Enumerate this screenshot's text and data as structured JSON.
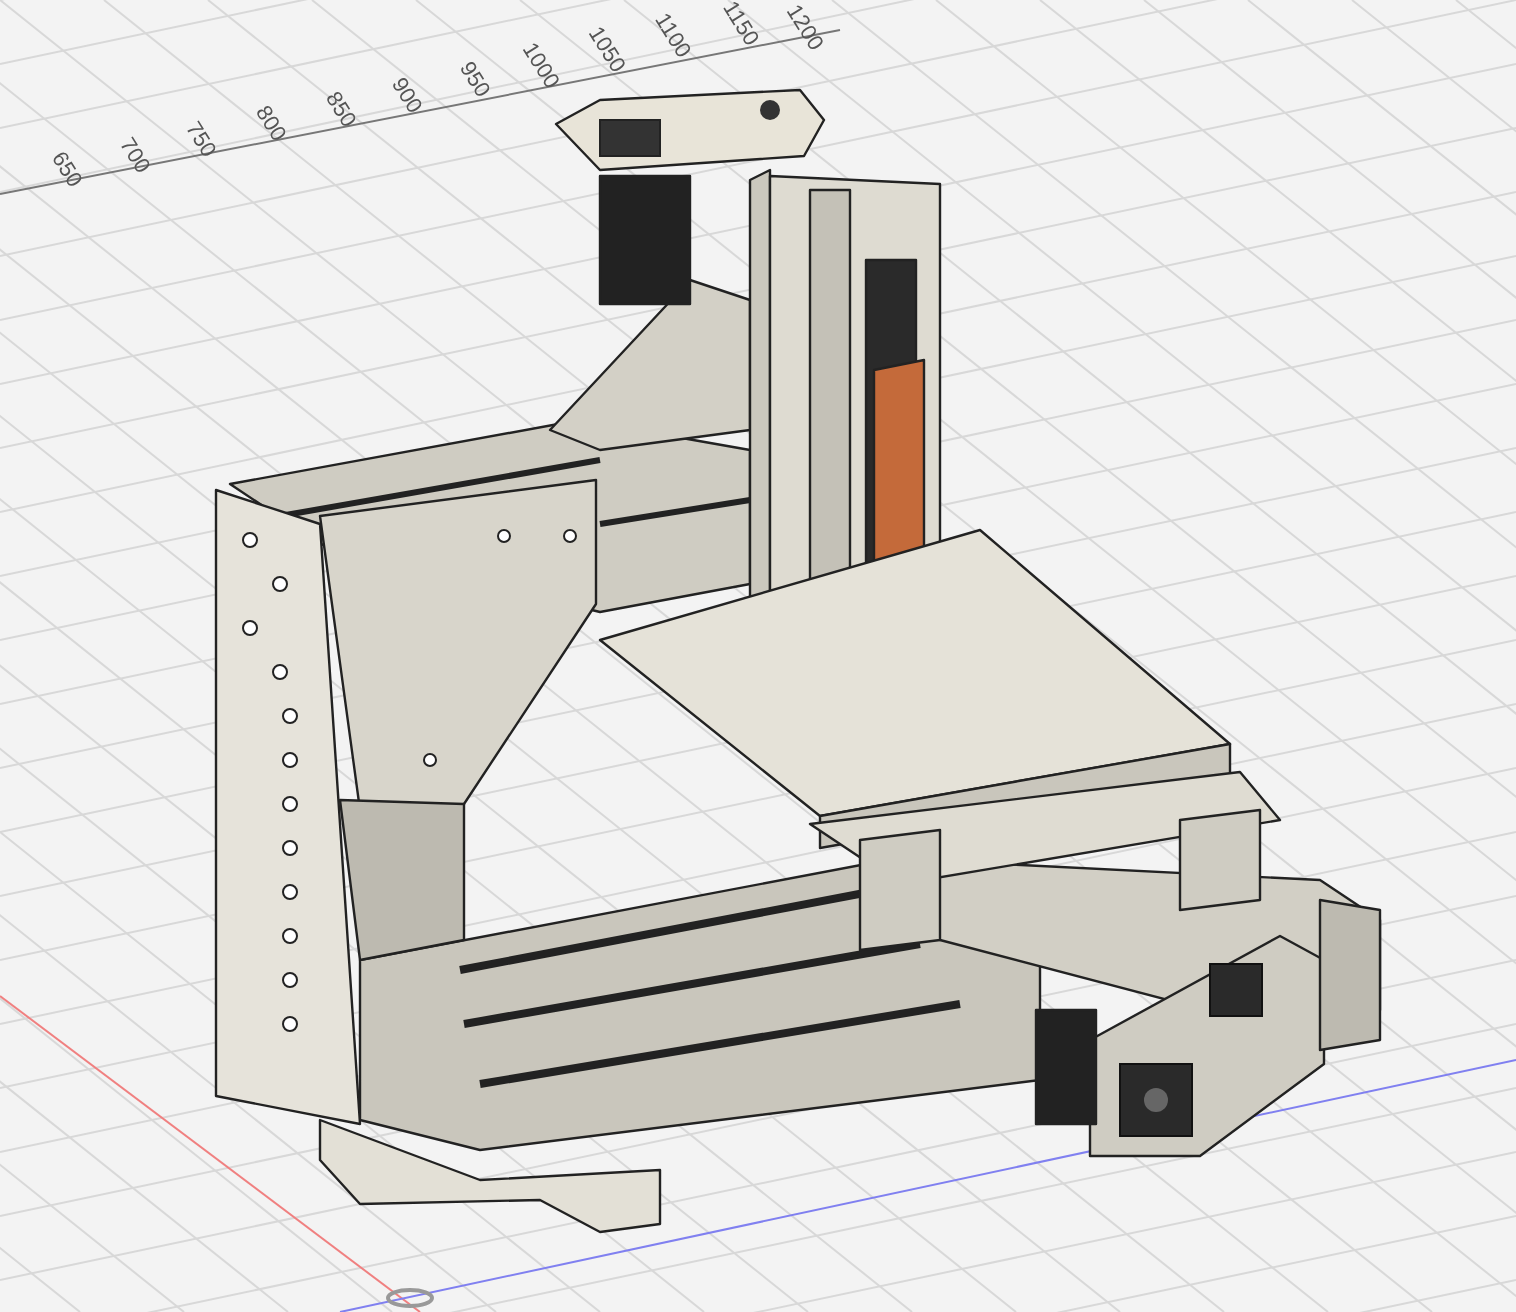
{
  "viewport": {
    "ruler": {
      "labels": [
        "650",
        "700",
        "750",
        "800",
        "850",
        "900",
        "950",
        "1000",
        "1050",
        "1100",
        "1150",
        "1200"
      ]
    }
  }
}
